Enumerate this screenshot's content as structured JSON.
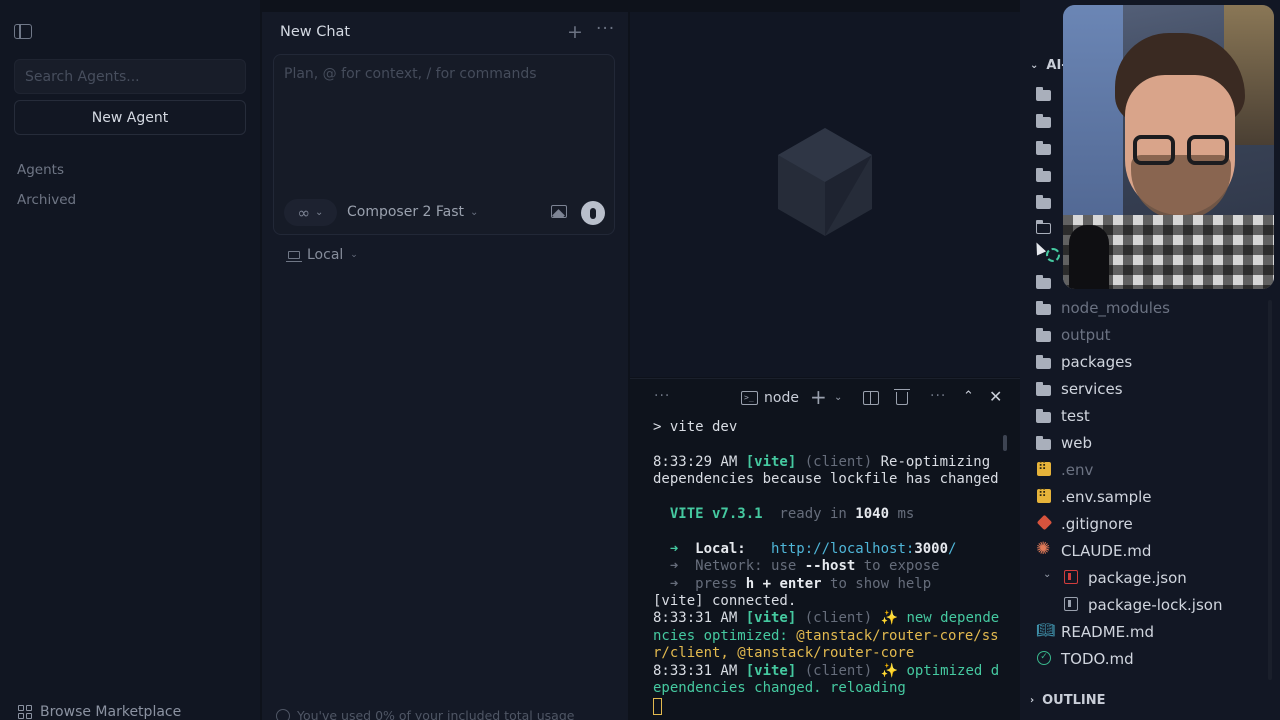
{
  "sidebar": {
    "search_placeholder": "Search Agents...",
    "new_agent_label": "New Agent",
    "agents_label": "Agents",
    "archived_label": "Archived",
    "browse_label": "Browse Marketplace"
  },
  "chat": {
    "title": "New Chat",
    "plus": "+",
    "more": "···",
    "composer_placeholder": "Plan, @ for context, / for commands",
    "mode_icon": "∞",
    "model_label": "Composer 2 Fast",
    "environment_label": "Local",
    "usage_text": "You've used 0% of your included total usage"
  },
  "terminal": {
    "toolbar": {
      "dots": "···",
      "shell_label": "node",
      "plus": "+",
      "more": "···",
      "collapse": "⌃",
      "close": "✕"
    },
    "lines": {
      "l1": "> vite dev",
      "l2_time": "8:33:29 AM ",
      "l2_tag": "[vite]",
      "l2_client": " (client) ",
      "l2_msg": "Re-optimizing",
      "l3": "dependencies because lockfile has changed",
      "l4_vite": "  VITE v7.3.1",
      "l4_ready": "  ready in ",
      "l4_ms": "1040",
      "l4_unit": " ms",
      "l5_arrow": "  ➜  ",
      "l5_label": "Local:",
      "l5_url_a": "   http://localhost:",
      "l5_port": "3000",
      "l5_url_b": "/",
      "l6_label": "Network:",
      "l6_use": " use ",
      "l6_host": "--host",
      "l6_rest": " to expose",
      "l7_press": "press ",
      "l7_key": "h + enter",
      "l7_rest": " to show help",
      "l8": "[vite] connected.",
      "l9_time": "8:33:31 AM ",
      "l9_tag": "[vite]",
      "l9_client": " (client) ",
      "l9_msg": "✨ new depende",
      "l10_a": "ncies optimized: ",
      "l10_b": "@tanstack/router-core/ss",
      "l11": "r/client, @tanstack/router-core",
      "l12_time": "8:33:31 AM ",
      "l12_tag": "[vite]",
      "l12_client": " (client) ",
      "l12_msg": "✨ optimized d",
      "l13": "ependencies changed. reloading"
    }
  },
  "explorer": {
    "root_label": "AI-",
    "items": [
      {
        "label": "node_modules"
      },
      {
        "label": "output"
      },
      {
        "label": "packages"
      },
      {
        "label": "services"
      },
      {
        "label": "test"
      },
      {
        "label": "web"
      },
      {
        "label": ".env"
      },
      {
        "label": ".env.sample"
      },
      {
        "label": ".gitignore"
      },
      {
        "label": "CLAUDE.md"
      },
      {
        "label": "package.json"
      },
      {
        "label": "package-lock.json"
      },
      {
        "label": "README.md"
      },
      {
        "label": "TODO.md"
      }
    ],
    "outline_label": "OUTLINE"
  },
  "colors": {
    "background": "#0e121b",
    "accent_green": "#45c9a0",
    "accent_yellow": "#e2b94f"
  },
  "icons": [
    "sidebar-toggle-icon",
    "grid-icon",
    "infinity-icon",
    "image-icon",
    "mic-icon",
    "laptop-icon",
    "terminal-icon",
    "split-icon",
    "trash-icon",
    "folder-icon",
    "spinner-icon"
  ]
}
